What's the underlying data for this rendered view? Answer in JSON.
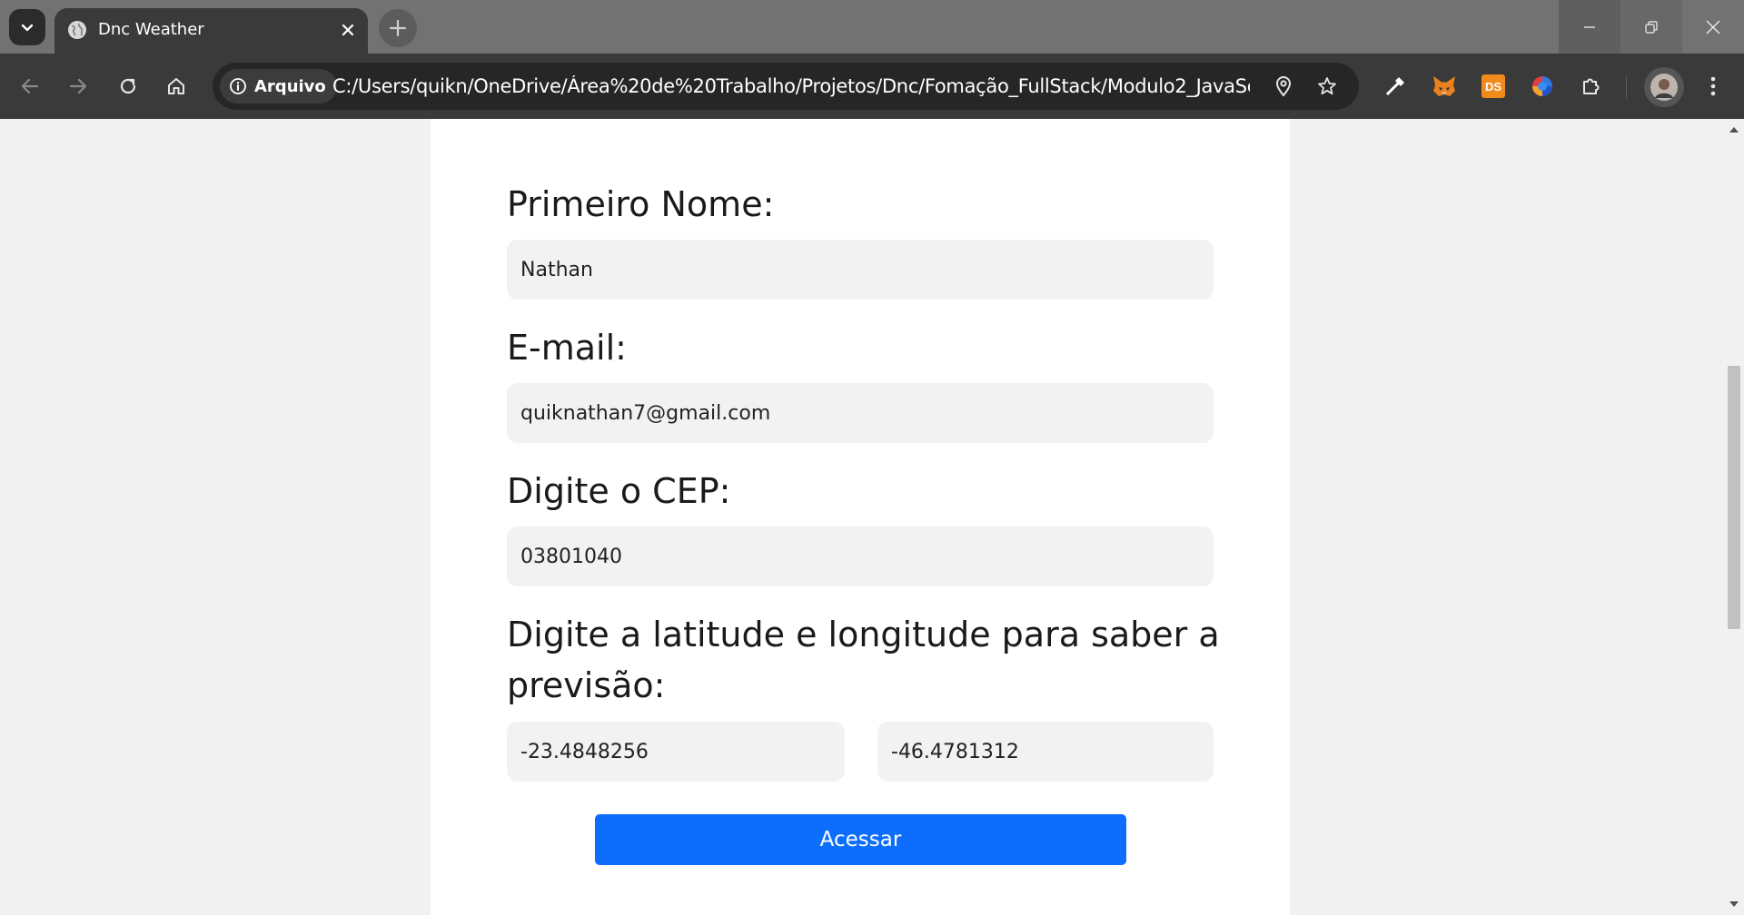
{
  "browser": {
    "tab": {
      "title": "Dnc Weather"
    },
    "omnibox": {
      "security_chip": "Arquivo",
      "url": "C:/Users/quikn/OneDrive/Área%20de%20Trabalho/Projetos/Dnc/Fomação_FullStack/Modulo2_JavaScript/D..."
    },
    "extensions": {
      "ds_badge": "DS"
    }
  },
  "form": {
    "first_name": {
      "label": "Primeiro Nome:",
      "value": "Nathan"
    },
    "email": {
      "label": "E-mail:",
      "value": "quiknathan7@gmail.com"
    },
    "cep": {
      "label": "Digite o CEP:",
      "value": "03801040"
    },
    "coordinates": {
      "label_line1": "Digite a latitude e longitude para saber a",
      "label_line2": "previsão:",
      "latitude": "-23.4848256",
      "longitude": "-46.4781312"
    },
    "submit_label": "Acessar"
  },
  "colors": {
    "submit_button": "#0d6efd",
    "field_background": "#f2f2f2",
    "page_background": "#f1f1f1",
    "browser_toolbar": "#3a3a3a"
  }
}
